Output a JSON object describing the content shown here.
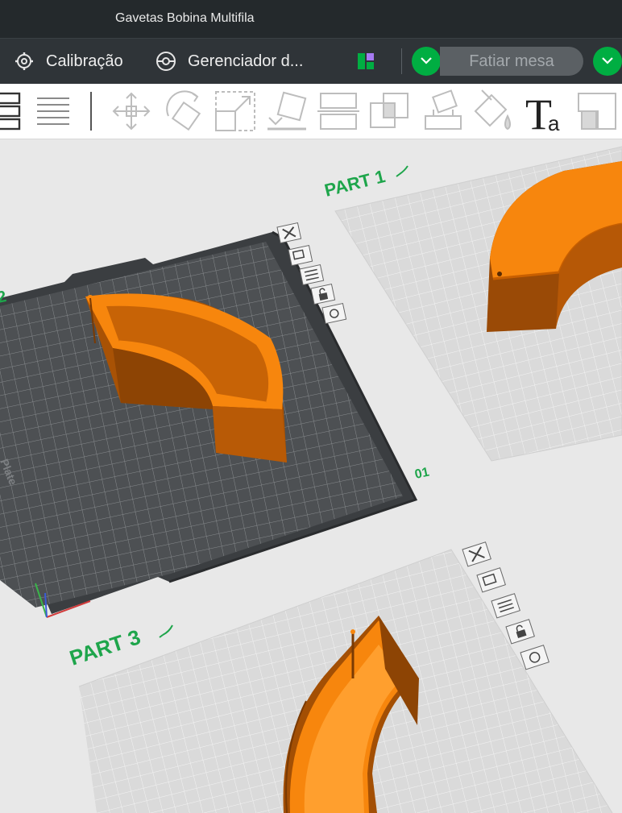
{
  "window": {
    "title": "Gavetas Bobina Multifila"
  },
  "menubar": {
    "calibration_label": "Calibração",
    "manager_label": "Gerenciador d...",
    "slice_label": "Fatiar mesa"
  },
  "toolbar": {
    "tools": [
      "list-view-icon",
      "layers-icon",
      "move-icon",
      "rotate-icon",
      "scale-icon",
      "lay-on-face-icon",
      "split-icon",
      "boolean-icon",
      "support-paint-icon",
      "color-paint-icon",
      "text-icon",
      "seam-icon"
    ]
  },
  "viewport": {
    "plates": [
      {
        "label": "PART 1",
        "state": "inactive"
      },
      {
        "label": "2",
        "state": "active"
      },
      {
        "label": "PART 3",
        "state": "inactive"
      }
    ],
    "plate_number": "01",
    "plate_brand": "Plate",
    "colors": {
      "filament": "#f7860d",
      "active_plate": "#4a4d50",
      "inactive_plate": "#d8d8d8",
      "label_green": "#1ea54b"
    }
  }
}
